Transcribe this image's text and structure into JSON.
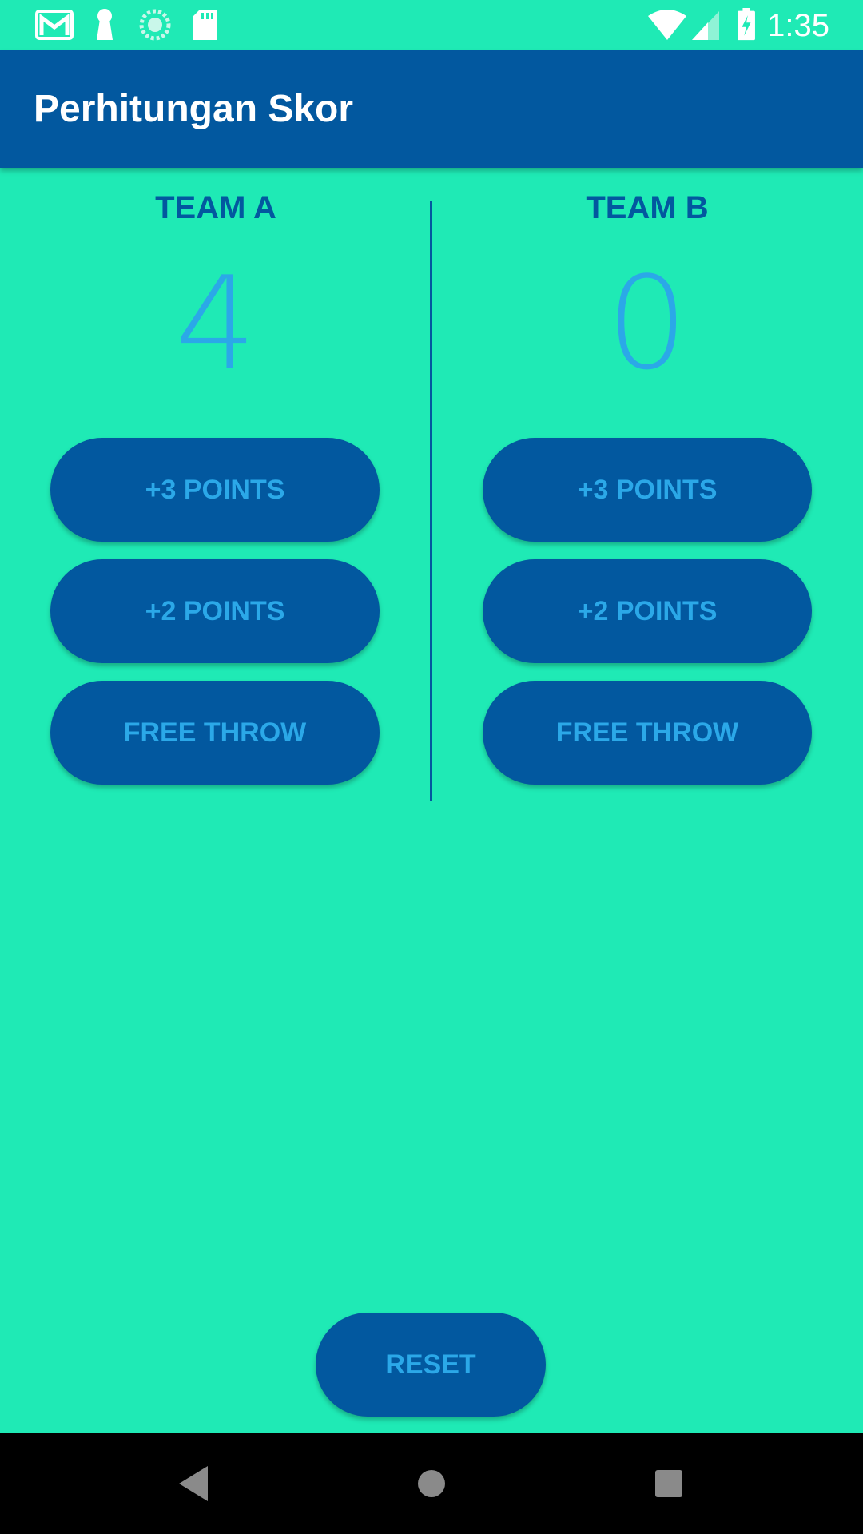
{
  "status_bar": {
    "time": "1:35",
    "left_icons": [
      "gmail-icon",
      "keyhole-icon",
      "sync-circle-icon",
      "sd-card-icon"
    ],
    "right_icons": [
      "wifi-icon",
      "signal-icon",
      "battery-charging-icon"
    ]
  },
  "app_bar": {
    "title": "Perhitungan Skor"
  },
  "team_a": {
    "name": "TEAM A",
    "score": "4",
    "buttons": {
      "three": "+3 POINTS",
      "two": "+2 POINTS",
      "free_throw": "FREE THROW"
    }
  },
  "team_b": {
    "name": "TEAM B",
    "score": "0",
    "buttons": {
      "three": "+3 POINTS",
      "two": "+2 POINTS",
      "free_throw": "FREE THROW"
    }
  },
  "reset": {
    "label": "RESET"
  },
  "nav": {
    "back": "back-icon",
    "home": "home-icon",
    "recents": "recents-icon"
  },
  "colors": {
    "background": "#1FEAB5",
    "primary": "#02589F",
    "accent_text": "#2BA8E8"
  }
}
